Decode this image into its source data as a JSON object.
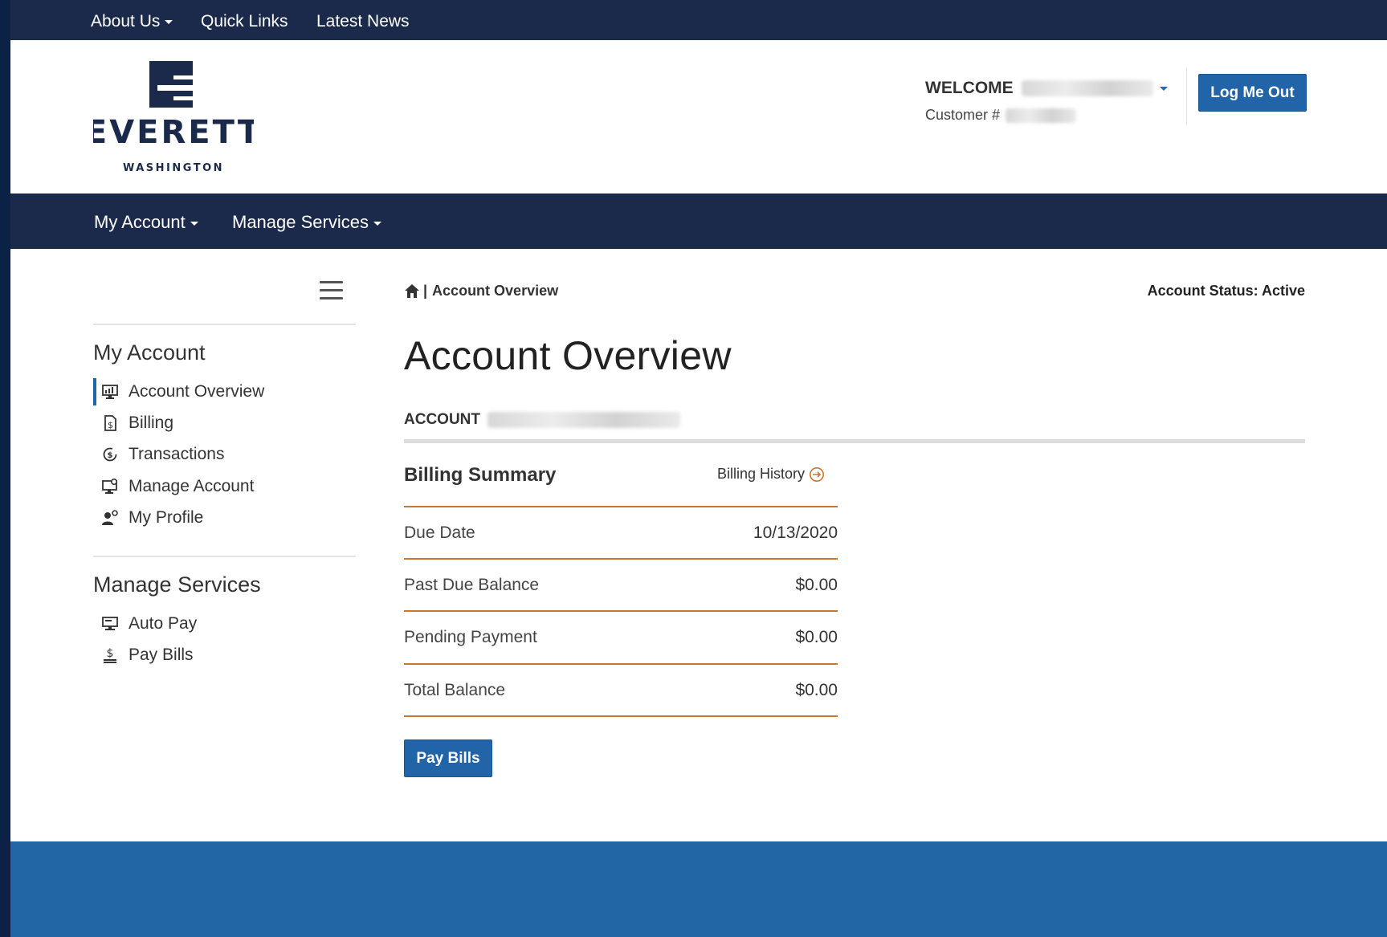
{
  "top_nav": {
    "about_us": "About Us",
    "quick_links": "Quick Links",
    "latest_news": "Latest News"
  },
  "logo": {
    "name": "EVERETT",
    "subtitle": "WASHINGTON"
  },
  "header": {
    "welcome_label": "WELCOME",
    "customer_label": "Customer #",
    "logout_label": "Log Me Out"
  },
  "main_nav": {
    "my_account": "My Account",
    "manage_services": "Manage Services"
  },
  "sidebar": {
    "my_account_heading": "My Account",
    "my_account_items": [
      {
        "label": "Account Overview",
        "icon": "monitor-chart-icon",
        "active": true
      },
      {
        "label": "Billing",
        "icon": "bill-dollar-icon"
      },
      {
        "label": "Transactions",
        "icon": "transactions-cycle-icon"
      },
      {
        "label": "Manage Account",
        "icon": "monitor-gear-icon"
      },
      {
        "label": "My Profile",
        "icon": "user-gear-icon"
      }
    ],
    "manage_services_heading": "Manage Services",
    "manage_services_items": [
      {
        "label": "Auto Pay",
        "icon": "auto-pay-monitor-icon"
      },
      {
        "label": "Pay Bills",
        "icon": "dollar-hand-icon"
      }
    ]
  },
  "breadcrumb": {
    "home_icon": "home-icon",
    "separator": "|",
    "current": "Account Overview"
  },
  "account_status": "Account Status: Active",
  "page_title": "Account Overview",
  "account_label": "ACCOUNT",
  "billing_summary": {
    "title": "Billing Summary",
    "history_link": "Billing History",
    "rows": [
      {
        "label": "Due Date",
        "value": "10/13/2020"
      },
      {
        "label": "Past Due Balance",
        "value": "$0.00"
      },
      {
        "label": "Pending Payment",
        "value": "$0.00"
      },
      {
        "label": "Total Balance",
        "value": "$0.00"
      }
    ]
  },
  "pay_bills_button": "Pay Bills",
  "colors": {
    "navy": "#1b2a4a",
    "primary_blue": "#2165a8",
    "accent_orange": "#c8782e",
    "footer_blue": "#2366a6"
  }
}
